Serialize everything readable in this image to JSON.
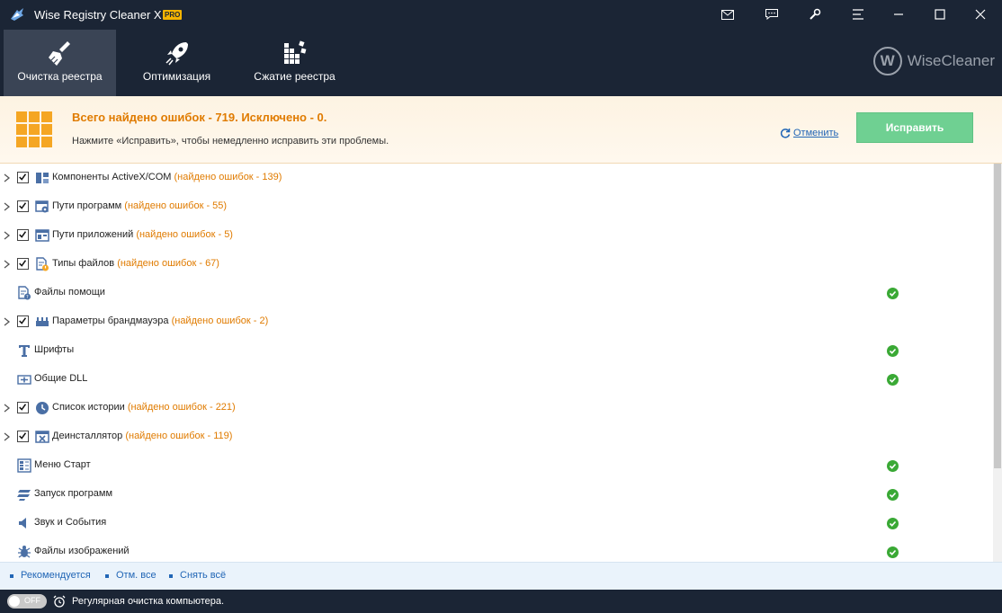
{
  "window": {
    "title": "Wise Registry Cleaner X",
    "badge": "PRO",
    "controls": [
      "mail-icon",
      "feedback-icon",
      "tools-icon",
      "menu-icon",
      "minimize-icon",
      "maximize-icon",
      "close-icon"
    ]
  },
  "nav": {
    "tabs": [
      {
        "label": "Очистка реестра",
        "icon": "broom-icon",
        "active": true
      },
      {
        "label": "Оптимизация",
        "icon": "rocket-icon",
        "active": false
      },
      {
        "label": "Сжатие реестра",
        "icon": "compress-icon",
        "active": false
      }
    ],
    "brand": "WiseCleaner",
    "brand_logo_letter": "W"
  },
  "summary": {
    "title": "Всего найдено ошибок - 719. Исключено - 0.",
    "subtitle": "Нажмите «Исправить», чтобы немедленно исправить эти проблемы.",
    "cancel_label": "Отменить",
    "fix_label": "Исправить"
  },
  "categories": [
    {
      "name": "Компоненты ActiveX/COM",
      "errors": "(найдено ошибок - 139)",
      "icon": "activex-icon",
      "expandable": true,
      "checked": true,
      "ok": false
    },
    {
      "name": "Пути программ",
      "errors": "(найдено ошибок - 55)",
      "icon": "program-paths-icon",
      "expandable": true,
      "checked": true,
      "ok": false
    },
    {
      "name": "Пути приложений",
      "errors": "(найдено ошибок - 5)",
      "icon": "app-paths-icon",
      "expandable": true,
      "checked": true,
      "ok": false
    },
    {
      "name": "Типы файлов",
      "errors": "(найдено ошибок - 67)",
      "icon": "file-types-icon",
      "expandable": true,
      "checked": true,
      "ok": false
    },
    {
      "name": "Файлы помощи",
      "errors": "",
      "icon": "help-files-icon",
      "expandable": false,
      "checked": false,
      "ok": true
    },
    {
      "name": "Параметры брандмауэра",
      "errors": "(найдено ошибок - 2)",
      "icon": "firewall-icon",
      "expandable": true,
      "checked": true,
      "ok": false
    },
    {
      "name": "Шрифты",
      "errors": "",
      "icon": "fonts-icon",
      "expandable": false,
      "checked": false,
      "ok": true
    },
    {
      "name": "Общие DLL",
      "errors": "",
      "icon": "dll-icon",
      "expandable": false,
      "checked": false,
      "ok": true
    },
    {
      "name": "Список истории",
      "errors": "(найдено ошибок - 221)",
      "icon": "history-icon",
      "expandable": true,
      "checked": true,
      "ok": false
    },
    {
      "name": "Деинсталлятор",
      "errors": "(найдено ошибок - 119)",
      "icon": "uninstaller-icon",
      "expandable": true,
      "checked": true,
      "ok": false
    },
    {
      "name": "Меню Старт",
      "errors": "",
      "icon": "start-menu-icon",
      "expandable": false,
      "checked": false,
      "ok": true
    },
    {
      "name": "Запуск программ",
      "errors": "",
      "icon": "startup-icon",
      "expandable": false,
      "checked": false,
      "ok": true
    },
    {
      "name": "Звук и События",
      "errors": "",
      "icon": "sound-icon",
      "expandable": false,
      "checked": false,
      "ok": true
    },
    {
      "name": "Файлы изображений",
      "errors": "",
      "icon": "image-files-icon",
      "expandable": false,
      "checked": false,
      "ok": true
    }
  ],
  "filters": {
    "recommended": "Рекомендуется",
    "uncheck_all": "Отм. все",
    "check_all": "Снять всё"
  },
  "status": {
    "toggle_label": "OFF",
    "text": "Регулярная очистка компьютера."
  },
  "colors": {
    "header_bg": "#1b2535",
    "active_tab": "#3a4455",
    "accent_orange": "#e07b00",
    "fix_button": "#6fd092",
    "link_blue": "#2166b6",
    "ok_green": "#3aa935"
  }
}
